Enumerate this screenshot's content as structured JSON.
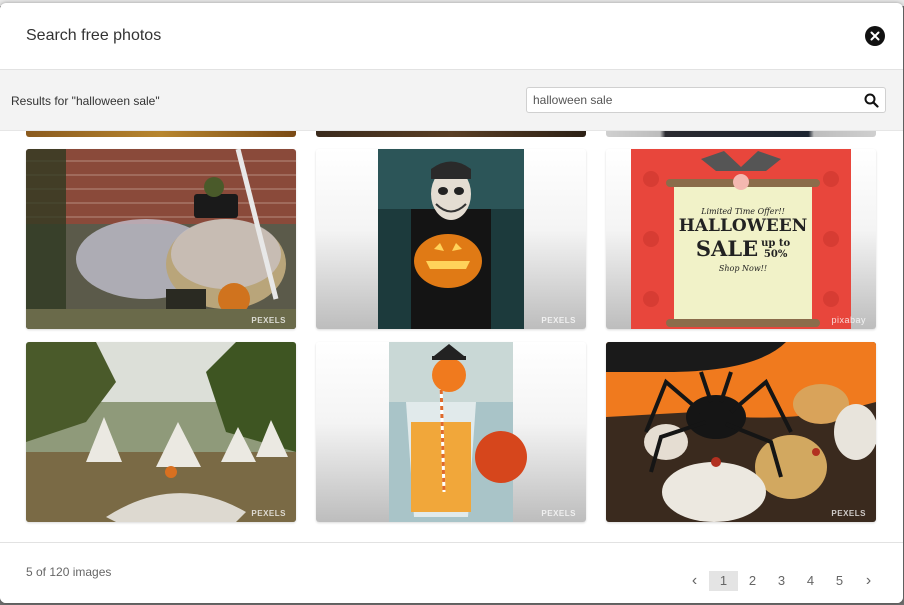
{
  "modal": {
    "title": "Search free photos"
  },
  "search": {
    "results_label": "Results for \"halloween sale\"",
    "query": "halloween sale"
  },
  "photos": [
    {
      "credit": "PEXELS",
      "subject": "halloween porch decoration"
    },
    {
      "credit": "PEXELS",
      "subject": "man holding jack-o-lantern"
    },
    {
      "credit": "pixabay",
      "subject": "halloween sale banner",
      "banner_lines": [
        "Limited Time Offer!!",
        "HALLOWEEN",
        "SALE",
        "up to",
        "50%",
        "Shop Now!!"
      ]
    },
    {
      "credit": "PEXELS",
      "subject": "people in ghost costumes"
    },
    {
      "credit": "PEXELS",
      "subject": "halloween drink with straw"
    },
    {
      "credit": "PEXELS",
      "subject": "spider on pumpkins"
    }
  ],
  "footer": {
    "count": "5 of 120 images",
    "prev": "‹",
    "next": "›",
    "pages": [
      "1",
      "2",
      "3",
      "4",
      "5"
    ],
    "current_page": "1"
  },
  "colors": {
    "accent_banner": "#e8463c",
    "close_button": "#111111"
  }
}
